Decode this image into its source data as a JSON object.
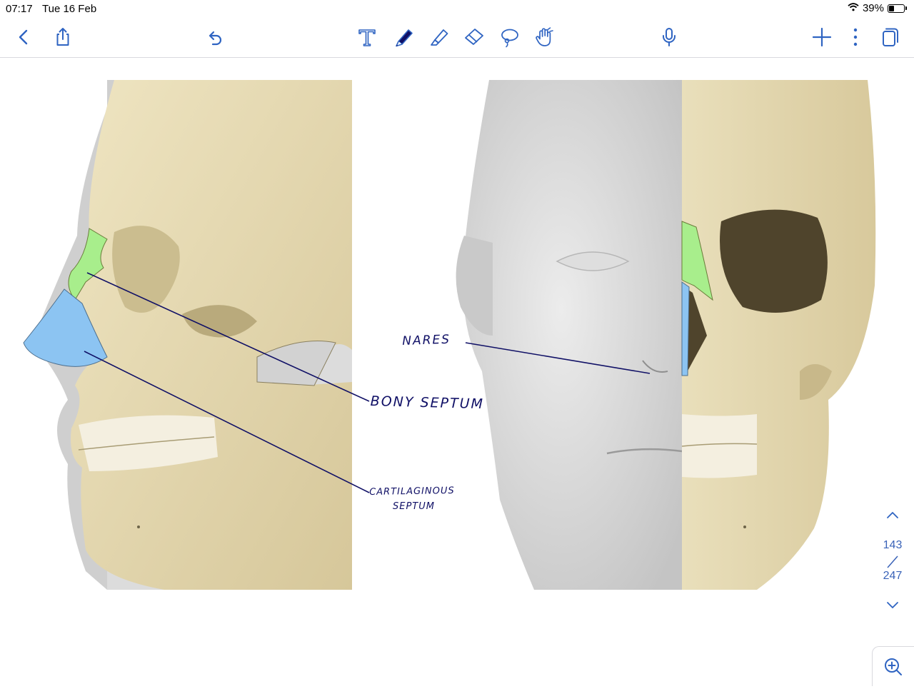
{
  "status_bar": {
    "time": "07:17",
    "date": "Tue 16 Feb",
    "battery_text": "39%",
    "battery_level": 0.39,
    "icons": [
      "wifi-icon",
      "battery-icon"
    ]
  },
  "toolbar": {
    "left": [
      "back-icon",
      "share-icon",
      "undo-icon"
    ],
    "center": [
      "text-tool-icon",
      "pen-tool-icon",
      "highlighter-tool-icon",
      "eraser-tool-icon",
      "lasso-tool-icon",
      "hand-tool-icon"
    ],
    "right": [
      "microphone-icon",
      "add-icon",
      "more-icon",
      "pages-icon"
    ],
    "active_tool": "pen-tool-icon",
    "accent_color": "#2f64c2"
  },
  "annotations": {
    "bony_septum": "BONY SEPTUM",
    "cartilaginous_septum_line1": "CARTILAGINOUS",
    "cartilaginous_septum_line2": "SEPTUM",
    "nares": "NARES",
    "ink_color": "#101066",
    "bony_septum_highlight": "#a8ee8c",
    "cartilage_highlight": "#8cc4f2"
  },
  "page_nav": {
    "current": "143",
    "total": "247"
  }
}
